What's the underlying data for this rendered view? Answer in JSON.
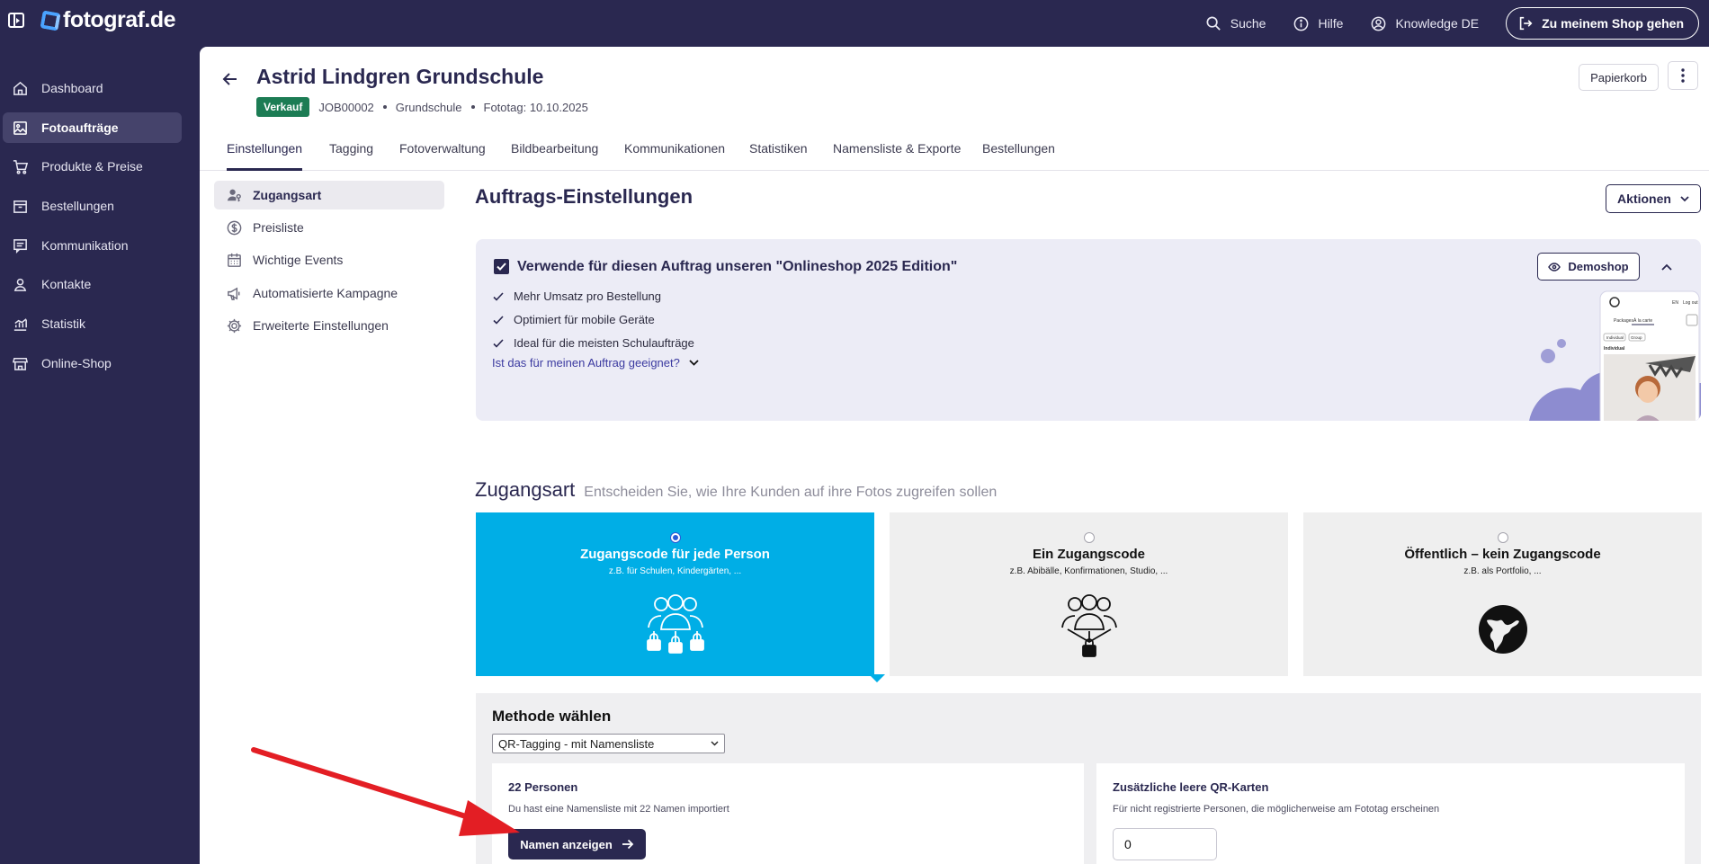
{
  "brand": {
    "logo_text": "fotograf.de"
  },
  "topbar": {
    "search_label": "Suche",
    "help_label": "Hilfe",
    "knowledge_label": "Knowledge DE",
    "shop_button_label": "Zu meinem Shop gehen"
  },
  "sidebar": {
    "items": [
      {
        "label": "Dashboard",
        "icon": "home-icon",
        "active": false
      },
      {
        "label": "Fotoaufträge",
        "icon": "image-icon",
        "active": true
      },
      {
        "label": "Produkte & Preise",
        "icon": "cart-icon",
        "active": false
      },
      {
        "label": "Bestellungen",
        "icon": "orders-icon",
        "active": false
      },
      {
        "label": "Kommunikation",
        "icon": "message-icon",
        "active": false
      },
      {
        "label": "Kontakte",
        "icon": "person-icon",
        "active": false
      },
      {
        "label": "Statistik",
        "icon": "chart-icon",
        "active": false
      },
      {
        "label": "Online-Shop",
        "icon": "store-icon",
        "active": false
      }
    ]
  },
  "job": {
    "title": "Astrid Lindgren Grundschule",
    "status_badge": "Verkauf",
    "job_id": "JOB00002",
    "type": "Grundschule",
    "photo_day": "Fototag: 10.10.2025",
    "trash_label": "Papierkorb"
  },
  "tabs": [
    {
      "label": "Einstellungen",
      "active": true
    },
    {
      "label": "Tagging",
      "active": false
    },
    {
      "label": "Fotoverwaltung",
      "active": false
    },
    {
      "label": "Bildbearbeitung",
      "active": false
    },
    {
      "label": "Kommunikationen",
      "active": false
    },
    {
      "label": "Statistiken",
      "active": false
    },
    {
      "label": "Namensliste & Exporte",
      "active": false
    },
    {
      "label": "Bestellungen",
      "active": false
    }
  ],
  "subnav": [
    {
      "label": "Zugangsart",
      "icon": "user-key-icon",
      "active": true
    },
    {
      "label": "Preisliste",
      "icon": "dollar-icon",
      "active": false
    },
    {
      "label": "Wichtige Events",
      "icon": "calendar-icon",
      "active": false
    },
    {
      "label": "Automatisierte Kampagne",
      "icon": "megaphone-icon",
      "active": false
    },
    {
      "label": "Erweiterte Einstellungen",
      "icon": "gear-icon",
      "active": false
    }
  ],
  "settings": {
    "title": "Auftrags-Einstellungen",
    "actions_label": "Aktionen"
  },
  "promo": {
    "checked": true,
    "title": "Verwende für diesen Auftrag unseren \"Onlineshop 2025 Edition\"",
    "demoshop_label": "Demoshop",
    "features": [
      "Mehr Umsatz pro Bestellung",
      "Optimiert für mobile Geräte",
      "Ideal für die meisten Schulaufträge"
    ],
    "suitable_link": "Ist das für meinen Auftrag geeignet?",
    "mock_text": {
      "tab1": "Packages",
      "tab2": "À la carte",
      "chip1": "Individual",
      "chip2": "Group",
      "heading": "Individual",
      "lang": "EN",
      "logout": "Log out"
    }
  },
  "access": {
    "title": "Zugangsart",
    "subtitle": "Entscheiden Sie, wie Ihre Kunden auf ihre Fotos zugreifen sollen",
    "options": [
      {
        "title": "Zugangscode für jede Person",
        "subtitle": "z.B. für Schulen, Kindergärten, ...",
        "selected": true
      },
      {
        "title": "Ein Zugangscode",
        "subtitle": "z.B. Abibälle, Konfirmationen, Studio, ...",
        "selected": false
      },
      {
        "title": "Öffentlich – kein Zugangscode",
        "subtitle": "z.B. als Portfolio, ...",
        "selected": false
      }
    ]
  },
  "method": {
    "title": "Methode wählen",
    "selected": "QR-Tagging - mit Namensliste",
    "persons": {
      "title": "22 Personen",
      "description": "Du hast eine Namensliste mit 22 Namen importiert",
      "button_label": "Namen anzeigen"
    },
    "qr_cards": {
      "title": "Zusätzliche leere QR-Karten",
      "description": "Für nicht registrierte Personen, die möglicherweise am Fototag erscheinen",
      "value": "0"
    }
  },
  "colors": {
    "navy": "#2a2850",
    "selected_card": "#00aee6",
    "badge_green": "#1c7c54",
    "annotation_arrow": "#e31e24"
  }
}
